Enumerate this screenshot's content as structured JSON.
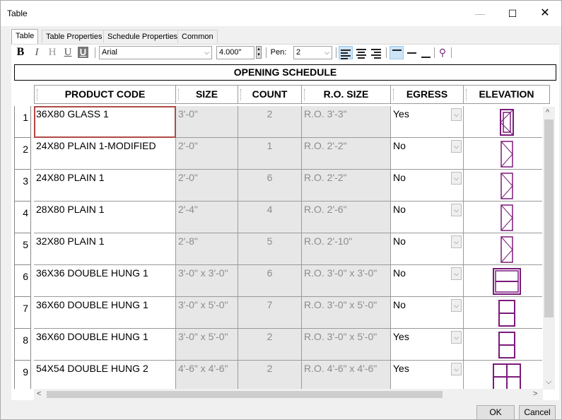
{
  "window": {
    "title": "Table"
  },
  "tabs": [
    "Table",
    "Table Properties",
    "Schedule Properties",
    "Common"
  ],
  "toolbar": {
    "bold": "B",
    "italic": "I",
    "outline": "H",
    "underline": "U",
    "shadow": "U",
    "font": "Arial",
    "size": "4.000\"",
    "pen_label": "Pen:",
    "pen_value": "2"
  },
  "schedule": {
    "title": "OPENING SCHEDULE",
    "columns": [
      "PRODUCT CODE",
      "SIZE",
      "COUNT",
      "R.O. SIZE",
      "EGRESS",
      "ELEVATION"
    ],
    "rows": [
      {
        "n": "1",
        "code": "36X80 GLASS 1",
        "size": "3'-0\"",
        "count": "2",
        "ro": "R.O. 3'-3\"",
        "egress": "Yes",
        "elev": "door-glass"
      },
      {
        "n": "2",
        "code": "24X80 PLAIN 1-MODIFIED",
        "size": "2'-0\"",
        "count": "1",
        "ro": "R.O. 2'-2\"",
        "egress": "No",
        "elev": "door-plain"
      },
      {
        "n": "3",
        "code": "24X80 PLAIN 1",
        "size": "2'-0\"",
        "count": "6",
        "ro": "R.O. 2'-2\"",
        "egress": "No",
        "elev": "door-plain"
      },
      {
        "n": "4",
        "code": "28X80 PLAIN 1",
        "size": "2'-4\"",
        "count": "4",
        "ro": "R.O. 2'-6\"",
        "egress": "No",
        "elev": "door-plain"
      },
      {
        "n": "5",
        "code": "32X80 PLAIN 1",
        "size": "2'-8\"",
        "count": "5",
        "ro": "R.O. 2'-10\"",
        "egress": "No",
        "elev": "door-plain"
      },
      {
        "n": "6",
        "code": "36X36 DOUBLE HUNG 1",
        "size": "3'-0\" x 3'-0\"",
        "count": "6",
        "ro": "R.O. 3'-0\" x 3'-0\"",
        "egress": "No",
        "elev": "window-square"
      },
      {
        "n": "7",
        "code": "36X60 DOUBLE HUNG 1",
        "size": "3'-0\" x 5'-0\"",
        "count": "7",
        "ro": "R.O. 3'-0\" x 5'-0\"",
        "egress": "No",
        "elev": "window-tall"
      },
      {
        "n": "8",
        "code": "36X60 DOUBLE HUNG 1",
        "size": "3'-0\" x 5'-0\"",
        "count": "2",
        "ro": "R.O. 3'-0\" x 5'-0\"",
        "egress": "Yes",
        "elev": "window-tall"
      },
      {
        "n": "9",
        "code": "54X54 DOUBLE HUNG 2",
        "size": "4'-6\" x 4'-6\"",
        "count": "2",
        "ro": "R.O. 4'-6\" x 4'-6\"",
        "egress": "Yes",
        "elev": "window-double"
      }
    ]
  },
  "buttons": {
    "ok": "OK",
    "cancel": "Cancel"
  },
  "colors": {
    "elevation": "#7b1a7b",
    "selection": "#b04a44"
  }
}
